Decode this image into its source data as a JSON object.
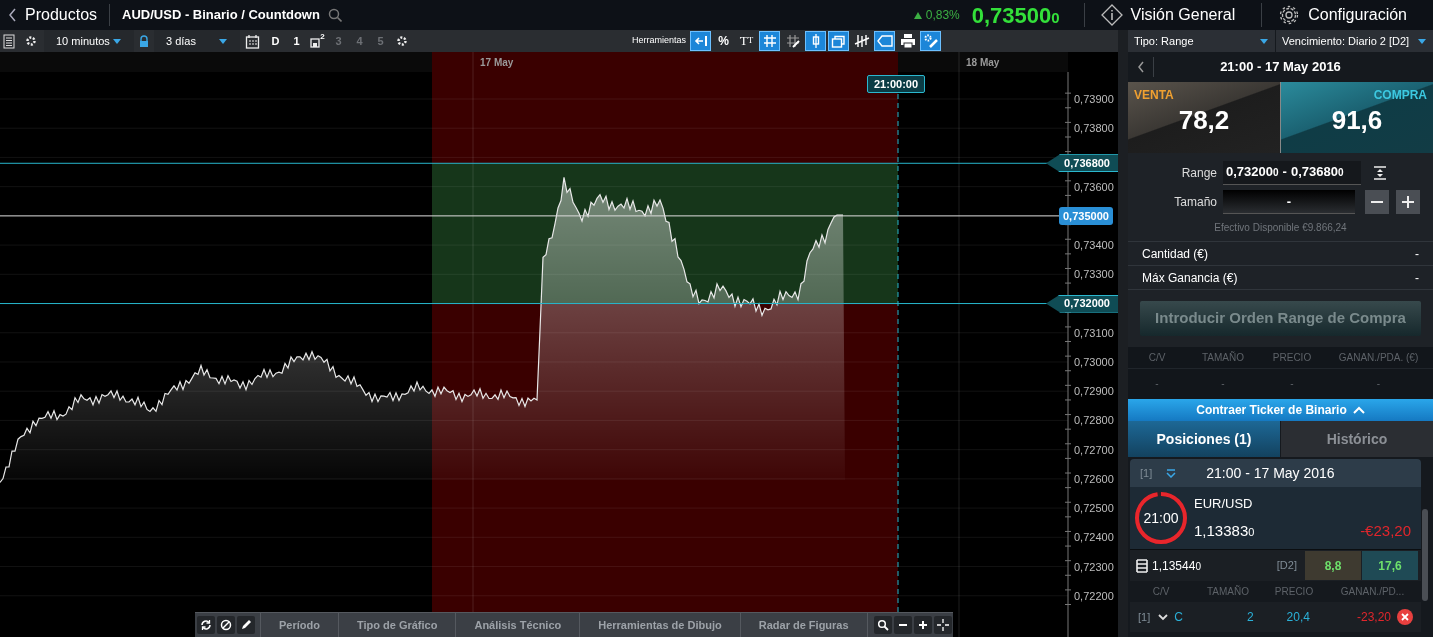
{
  "header": {
    "back_label": "Productos",
    "instrument": "AUD/USD - Binario / Countdown",
    "change": "0,83%",
    "price": {
      "main": "0,73500",
      "tail": "0"
    },
    "nav": [
      {
        "kind": "info",
        "label": "Visión General"
      },
      {
        "kind": "gear",
        "label": "Configuración"
      }
    ]
  },
  "toolbar": {
    "interval": "10 minutos",
    "span": "3 días",
    "buttons": [
      {
        "kind": "text",
        "label": "D",
        "disabled": false
      },
      {
        "kind": "text",
        "label": "1",
        "disabled": false
      },
      {
        "kind": "save",
        "label": "2",
        "disabled": false
      },
      {
        "kind": "text",
        "label": "3",
        "disabled": true
      },
      {
        "kind": "text",
        "label": "4",
        "disabled": true
      },
      {
        "kind": "text",
        "label": "5",
        "disabled": true
      }
    ],
    "tools_label": "Herramientas",
    "tools": [
      {
        "kind": "back",
        "selected": true
      },
      {
        "kind": "percent",
        "label": "%",
        "selected": false
      },
      {
        "kind": "text",
        "label": "TT",
        "selected": false
      },
      {
        "kind": "grid",
        "selected": true
      },
      {
        "kind": "gridpen",
        "selected": false
      },
      {
        "kind": "candle",
        "selected": true
      },
      {
        "kind": "windows",
        "selected": true
      },
      {
        "kind": "bars",
        "selected": false
      },
      {
        "kind": "tag",
        "selected": true
      },
      {
        "kind": "print",
        "selected": false
      },
      {
        "kind": "wand",
        "selected": true
      }
    ]
  },
  "chart": {
    "dates": [
      "17 May",
      "18 May"
    ],
    "expiry_time": "21:00:00",
    "axis_labels": [
      "0,73900",
      "0,73800",
      "0,73600",
      "0,73400",
      "0,73300",
      "0,73100",
      "0,73000",
      "0,72900",
      "0,72800",
      "0,72700",
      "0,72600",
      "0,72500",
      "0,72400",
      "0,72300",
      "0,72200"
    ],
    "price_tags": [
      {
        "kind": "range",
        "label": "0,736800"
      },
      {
        "kind": "current",
        "label": "0,735000"
      },
      {
        "kind": "range",
        "label": "0,732000"
      }
    ]
  },
  "bottom_bar": {
    "tabs": [
      "Período",
      "Tipo de Gráfico",
      "Análisis Técnico",
      "Herramientas de Dibujo",
      "Radar de Figuras"
    ]
  },
  "panel": {
    "type_select": "Tipo: Range",
    "expiry_select": "Vencimiento: Diario 2 [D2]",
    "title": "21:00 - 17 May 2016",
    "quotes": [
      {
        "kind": "venta",
        "label": "VENTA",
        "value": "78,2"
      },
      {
        "kind": "compra",
        "label": "COMPRA",
        "value": "91,6"
      }
    ],
    "range_label": "Range",
    "range_low": {
      "main": "0,73200",
      "tail": "0"
    },
    "range_sep": "-",
    "range_high": {
      "main": "0,73680",
      "tail": "0"
    },
    "size_label": "Tamaño",
    "size_value": "-",
    "cash": "Efectivo Disponible €9.866,24",
    "summary": [
      {
        "label": "Cantidad (€)",
        "value": "-"
      },
      {
        "label": "Máx Ganancia (€)",
        "value": "-"
      }
    ],
    "order_button": {
      "label": "Introducir Orden Range de Compra",
      "disabled": true
    },
    "orders_columns": [
      "C/V",
      "TAMAÑO",
      "PRECIO",
      "GANAN./PDA. (€)"
    ],
    "orders_row": [
      "-",
      "-",
      "-",
      "-"
    ],
    "collapse_label": "Contraer Ticker de Binario",
    "tabs": [
      {
        "label": "Posiciones (1)",
        "selected": true
      },
      {
        "label": "Histórico",
        "selected": false
      }
    ],
    "position": {
      "index": "[1]",
      "time": "21:00 - 17 May 2016",
      "timer": "21:00",
      "level": 0.97,
      "pair": "EUR/USD",
      "price": {
        "main": "1,13383",
        "tail": "0"
      },
      "pnl": "-€23,20",
      "strike": {
        "main": "1,13544",
        "tail": "0"
      },
      "expiry_code": "[D2]",
      "sell": "8,8",
      "buy": "17,6",
      "columns": [
        "C/V",
        "TAMAÑO",
        "PRECIO",
        "GANAN./PD..."
      ],
      "trade": {
        "index": "[1]",
        "side": "C",
        "size": "2",
        "price": "20,4",
        "pnl": "-23,20"
      }
    }
  }
}
